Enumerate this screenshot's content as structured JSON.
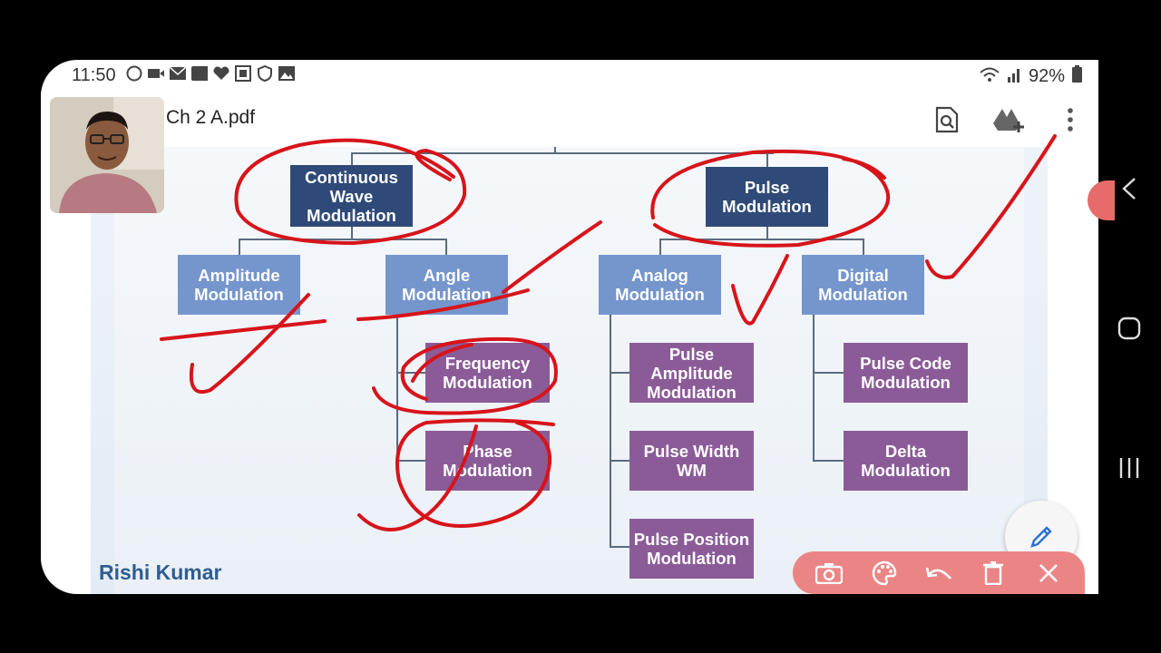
{
  "status": {
    "time": "11:50",
    "battery": "92%",
    "icons": [
      "whatsapp-icon",
      "video-icon",
      "mail-icon",
      "paytm-icon",
      "heart-icon",
      "qr-icon",
      "shield-icon",
      "gallery-icon"
    ],
    "right_icons": [
      "wifi-icon",
      "signal-icon",
      "battery-icon"
    ]
  },
  "appbar": {
    "title": "Ch 2 A.pdf",
    "actions": [
      "search-document-icon",
      "drive-add-icon",
      "more-vert-icon"
    ]
  },
  "slide": {
    "cw": "Continuous\nWave\nModulation",
    "pm": "Pulse\nModulation",
    "am": "Amplitude\nModulation",
    "angle": "Angle\nModulation",
    "analog": "Analog\nModulation",
    "digital": "Digital\nModulation",
    "fm": "Frequency\nModulation",
    "phm": "Phase\nModulation",
    "pam": "Pulse\nAmplitude\nModulation",
    "pwm": "Pulse Width\nWM",
    "ppm": "Pulse Position\nModulation",
    "pcm": "Pulse Code\nModulation",
    "dm": "Delta\nModulation",
    "author": "Rishi Kumar"
  },
  "colors": {
    "dark_box": "#2f4a78",
    "blue_box": "#7595cd",
    "purple_box": "#8b5b98",
    "ink": "#d7141a",
    "toolbar": "#eb8585"
  },
  "toolbar": [
    "camera-icon",
    "palette-icon",
    "undo-icon",
    "delete-icon",
    "close-icon"
  ],
  "nav": [
    "back-chevron-icon",
    "home-icon",
    "recents-icon"
  ]
}
